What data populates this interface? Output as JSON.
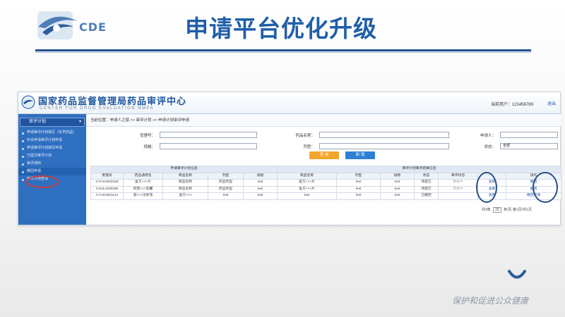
{
  "slide": {
    "logo_text": "CDE",
    "title": "申请平台优化升级",
    "slogan": "保护和促进公众健康"
  },
  "system": {
    "name_cn": "国家药品监督管理局药品审评中心",
    "name_en": "CENTER FOR DRUG EVALUATION NMPA",
    "user": "当前用户：123456789",
    "logout": "退出"
  },
  "sidebar": {
    "header": "审评计划",
    "items": [
      {
        "label": "申请审评计划填写（化学药品）"
      },
      {
        "label": "补充申请审评计划申请"
      },
      {
        "label": "申请审评计划填写申请"
      },
      {
        "label": "已提交审评计划"
      },
      {
        "label": "审评通知"
      },
      {
        "label": "撤回申请"
      },
      {
        "label": "审评计划查询"
      }
    ]
  },
  "breadcrumb": "当前位置：申请人之窗 >> 审评计划 >> 申请计划审评申请",
  "form": {
    "labels": {
      "l1": "受理号：",
      "l2": "药品名称：",
      "l3": "申请人：",
      "l4": "规格：",
      "l5": "剂型：",
      "l6": "状态："
    },
    "status_value": "全部",
    "query_label": "查 询",
    "new_label": "新 增"
  },
  "table": {
    "group_headers": [
      "申请审评计划信息",
      "审评计划审评结果信息"
    ],
    "columns": [
      "受理号",
      "药品通用名",
      "商品名称",
      "剂型",
      "规格",
      "商品名称",
      "剂型",
      "规格",
      "状态",
      "审评状态",
      "",
      "操作"
    ],
    "rows": [
      [
        "CYHS1840188",
        "复方×××片",
        "商品名称",
        "药品剂型",
        "test",
        "复方×××片",
        "test",
        "test",
        "待提交",
        "审核中",
        "查看",
        "撤回"
      ],
      [
        "CXHL1600286",
        "阿莫×××胶囊",
        "商品名称",
        "药品剂型",
        "test",
        "复方×××片",
        "test",
        "test",
        "待提交",
        "审核中",
        "查看",
        "撤回"
      ],
      [
        "CYHS1801141",
        "氯×××注射液",
        "复方×××",
        "test",
        "test",
        "test",
        "test",
        "test",
        "已撤回",
        "",
        "查看",
        "撤回申请"
      ]
    ]
  },
  "pager": {
    "total": "共3条",
    "page_size": "20",
    "suffix": "条/页  第1页/共1页"
  },
  "colors": {
    "title_blue": "#1f5ea8",
    "sidebar_blue": "#2f6fc0",
    "query_orange": "#f3a52b",
    "new_blue": "#2d7fd3",
    "highlight_red": "#c83b3b"
  }
}
